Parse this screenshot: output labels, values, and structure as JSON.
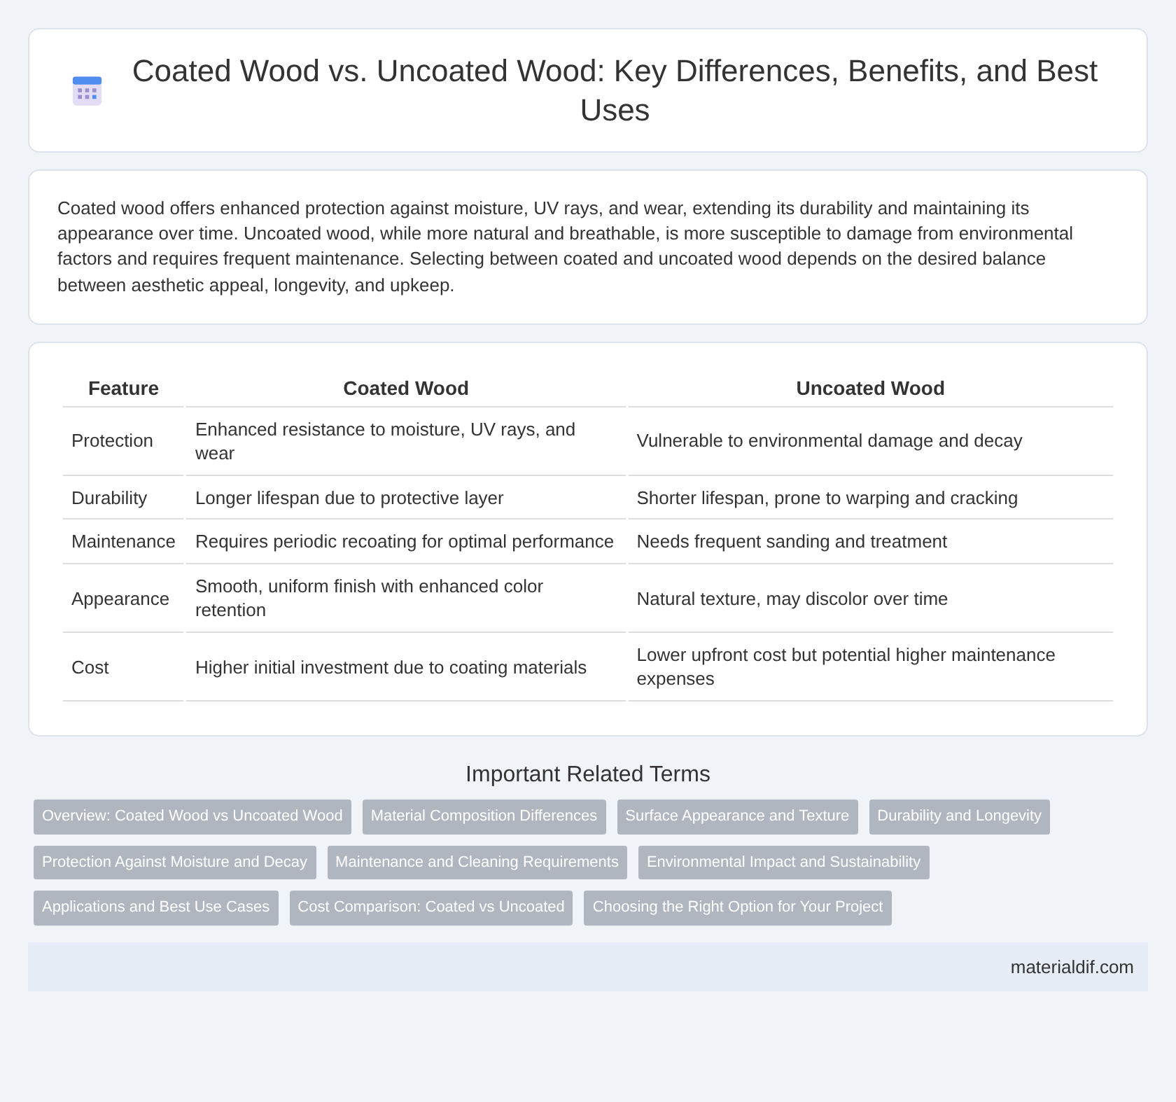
{
  "header": {
    "title": "Coated Wood vs. Uncoated Wood: Key Differences, Benefits, and Best Uses"
  },
  "summary": "Coated wood offers enhanced protection against moisture, UV rays, and wear, extending its durability and maintaining its appearance over time. Uncoated wood, while more natural and breathable, is more susceptible to damage from environmental factors and requires frequent maintenance. Selecting between coated and uncoated wood depends on the desired balance between aesthetic appeal, longevity, and upkeep.",
  "table": {
    "columns": [
      "Feature",
      "Coated Wood",
      "Uncoated Wood"
    ],
    "rows": [
      [
        "Protection",
        "Enhanced resistance to moisture, UV rays, and wear",
        "Vulnerable to environmental damage and decay"
      ],
      [
        "Durability",
        "Longer lifespan due to protective layer",
        "Shorter lifespan, prone to warping and cracking"
      ],
      [
        "Maintenance",
        "Requires periodic recoating for optimal performance",
        "Needs frequent sanding and treatment"
      ],
      [
        "Appearance",
        "Smooth, uniform finish with enhanced color retention",
        "Natural texture, may discolor over time"
      ],
      [
        "Cost",
        "Higher initial investment due to coating materials",
        "Lower upfront cost but potential higher maintenance expenses"
      ]
    ]
  },
  "related": {
    "title": "Important Related Terms",
    "tags": [
      "Overview: Coated Wood vs Uncoated Wood",
      "Material Composition Differences",
      "Surface Appearance and Texture",
      "Durability and Longevity",
      "Protection Against Moisture and Decay",
      "Maintenance and Cleaning Requirements",
      "Environmental Impact and Sustainability",
      "Applications and Best Use Cases",
      "Cost Comparison: Coated vs Uncoated",
      "Choosing the Right Option for Your Project"
    ]
  },
  "footer": {
    "site": "materialdif.com"
  }
}
